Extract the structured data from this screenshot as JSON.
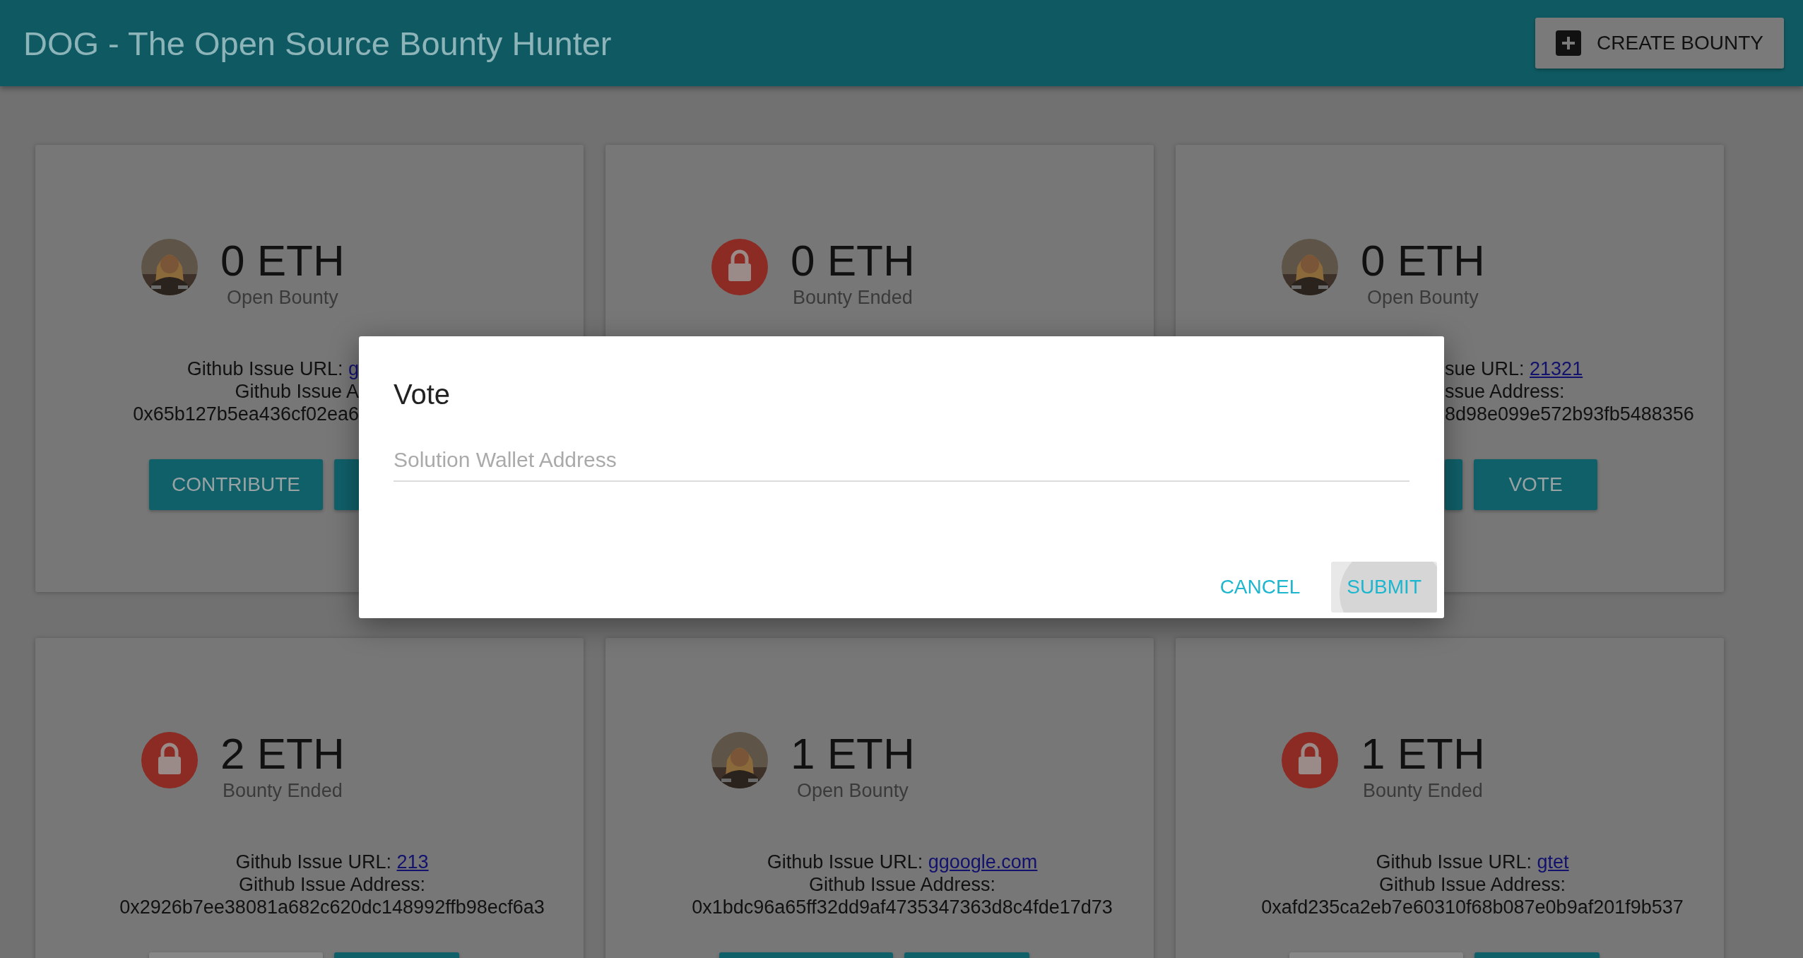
{
  "header": {
    "title": "DOG - The Open Source Bounty Hunter",
    "action": {
      "label": "CREATE BOUNTY"
    }
  },
  "cards": [
    {
      "kind": "open",
      "amount": "0 ETH",
      "status": "Open Bounty",
      "lines": [
        {
          "label": "Github Issue URL: ",
          "link": "g"
        },
        {
          "label": "Github Issue A"
        },
        {
          "label": "0x65b127b5ea436cf02ea6"
        }
      ],
      "buttons": [
        {
          "label": "CONTRIBUTE",
          "disabled": false
        },
        {
          "disabled": false
        }
      ]
    },
    {
      "kind": "ended",
      "amount": "0 ETH",
      "status": "Bounty Ended"
    },
    {
      "kind": "open",
      "amount": "0 ETH",
      "status": "Open Bounty",
      "lines": [
        {
          "label": "sue URL: ",
          "link": "21321"
        },
        {
          "label": "ssue Address:"
        },
        {
          "label": "8d98e099e572b93fb5488356"
        }
      ],
      "buttons": [
        {
          "disabled": false
        },
        {
          "label": "VOTE",
          "disabled": false
        }
      ]
    },
    {
      "kind": "ended",
      "amount": "2 ETH",
      "status": "Bounty Ended",
      "lines": [
        {
          "label": "Github Issue URL: ",
          "link": "213"
        },
        {
          "label": "Github Issue Address:"
        },
        {
          "label": "0x2926b7ee38081a682c620dc148992ffb98ecf6a3"
        }
      ],
      "buttons": [
        {
          "disabled": true
        },
        {
          "disabled": false
        }
      ]
    },
    {
      "kind": "open",
      "amount": "1 ETH",
      "status": "Open Bounty",
      "lines": [
        {
          "label": "Github Issue URL: ",
          "link": "ggoogle.com"
        },
        {
          "label": "Github Issue Address:"
        },
        {
          "label": "0x1bdc96a65ff32dd9af4735347363d8c4fde17d73"
        }
      ],
      "buttons": [
        {
          "disabled": false
        },
        {
          "disabled": false
        }
      ]
    },
    {
      "kind": "ended",
      "amount": "1 ETH",
      "status": "Bounty Ended",
      "lines": [
        {
          "label": "Github Issue URL: ",
          "link": "gtet"
        },
        {
          "label": "Github Issue Address:"
        },
        {
          "label": "0xafd235ca2eb7e60310f68b087e0b9af201f9b537"
        }
      ],
      "buttons": [
        {
          "disabled": true
        },
        {
          "disabled": false
        }
      ]
    }
  ],
  "dialog": {
    "title": "Vote",
    "field": {
      "placeholder": "Solution Wallet Address"
    },
    "actions": [
      {
        "label": "CANCEL",
        "focused": false
      },
      {
        "label": "SUBMIT",
        "focused": true
      }
    ]
  }
}
